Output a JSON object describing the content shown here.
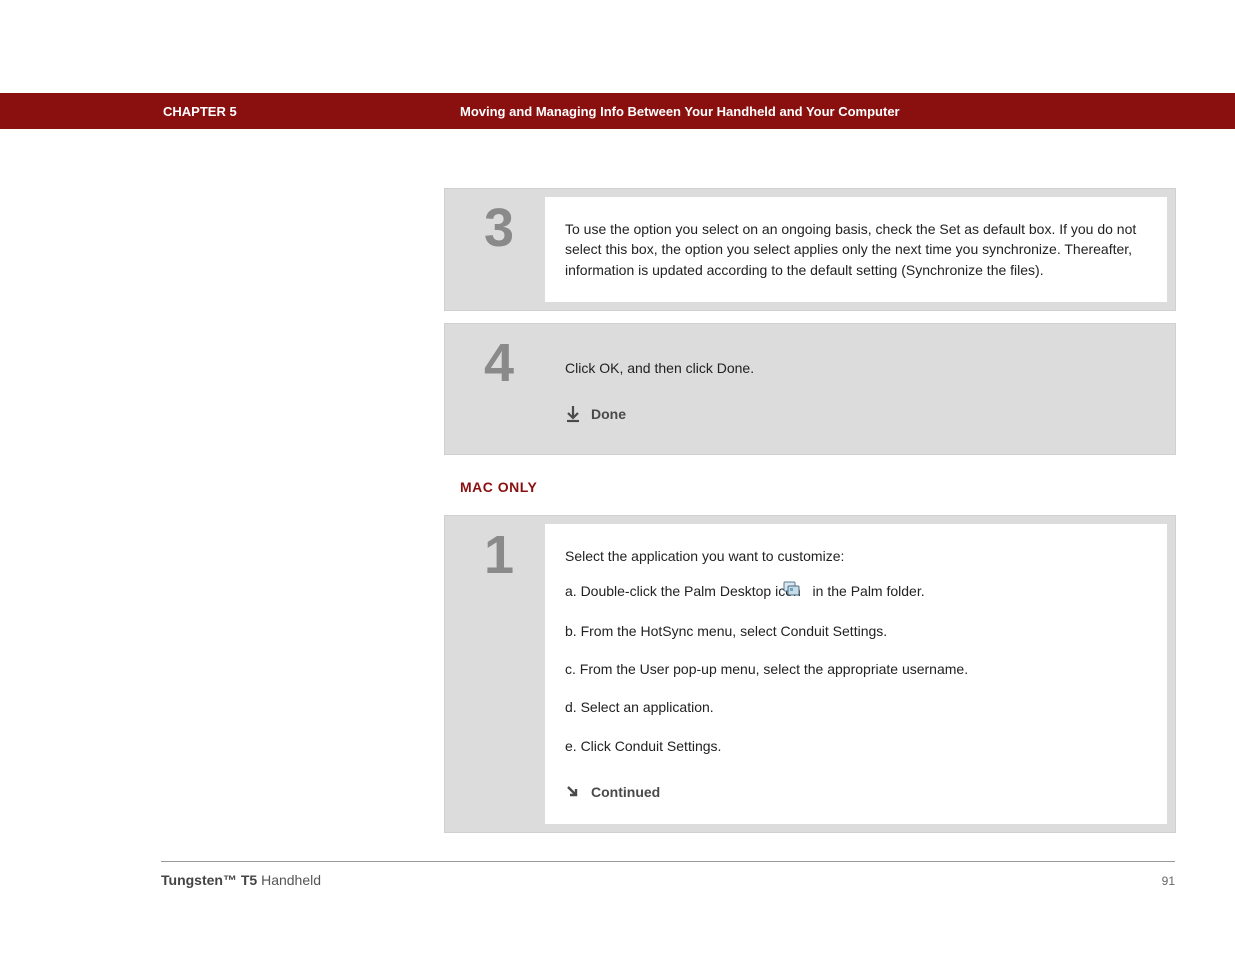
{
  "header": {
    "chapter": "CHAPTER 5",
    "title": "Moving and Managing Info Between Your Handheld and Your Computer"
  },
  "steps_top": [
    {
      "num": "3",
      "text": "To use the option you select on an ongoing basis, check the Set as default box. If you do not select this box, the option you select applies only the next time you synchronize. Thereafter, information is updated according to the default setting (Synchronize the files)."
    },
    {
      "num": "4",
      "text": "Click OK, and then click Done.",
      "done_label": "Done"
    }
  ],
  "section_label": "MAC ONLY",
  "mac_step": {
    "num": "1",
    "intro": "Select the application you want to customize:",
    "items": {
      "a_prefix": "a.  Double-click the Palm Desktop icon ",
      "a_suffix": " in the Palm folder.",
      "b": "b.  From the HotSync menu, select Conduit Settings.",
      "c": "c.  From the User pop-up menu, select the appropriate username.",
      "d": "d.  Select an application.",
      "e": "e.  Click Conduit Settings."
    },
    "continued_label": "Continued"
  },
  "footer": {
    "product_bold": "Tungsten™ T5",
    "product_rest": " Handheld",
    "page": "91"
  }
}
